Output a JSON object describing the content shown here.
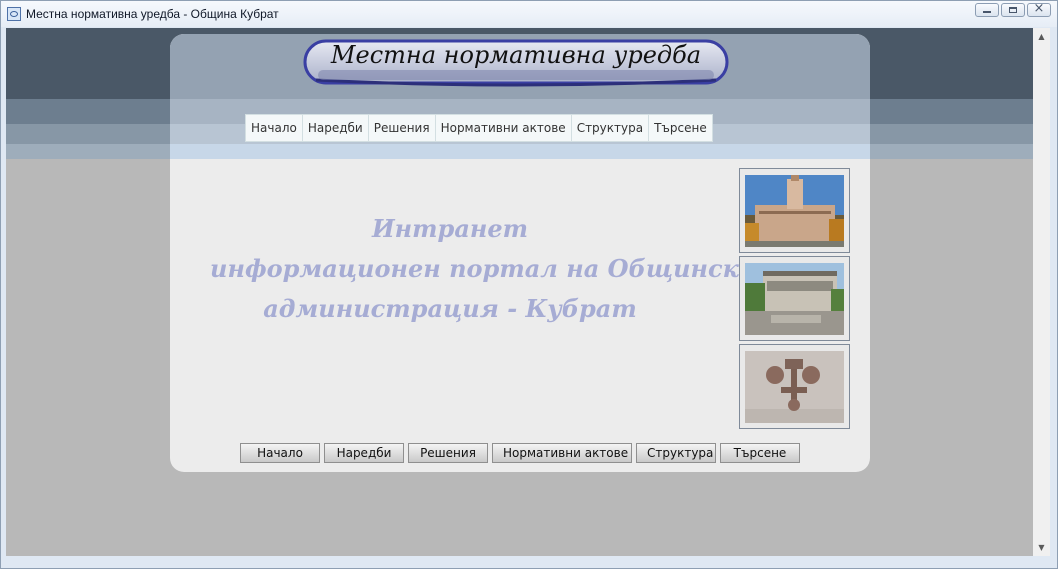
{
  "window": {
    "title": "Местна нормативна уредба - Община Кубрат"
  },
  "banner": {
    "title": "Местна нормативна уредба"
  },
  "top_nav": [
    {
      "label": "Начало"
    },
    {
      "label": "Наредби"
    },
    {
      "label": "Решения"
    },
    {
      "label": "Нормативни актове"
    },
    {
      "label": "Структура"
    },
    {
      "label": "Търсене"
    }
  ],
  "intro": {
    "line1": "Интранет",
    "line2": "информационен портал на Общинска",
    "line3": "администрация - Кубрат"
  },
  "photos": [
    {
      "name": "town-hall-photo"
    },
    {
      "name": "building-photo"
    },
    {
      "name": "monument-relief-photo"
    }
  ],
  "bottom_nav": [
    {
      "label": "Начало"
    },
    {
      "label": "Наредби"
    },
    {
      "label": "Решения"
    },
    {
      "label": "Нормативни актове"
    },
    {
      "label": "Структура"
    },
    {
      "label": "Търсене"
    }
  ],
  "colors": {
    "intro_text": "#a6acd4",
    "banner_border": "#3a3fa3",
    "header_band": "#4a5867"
  }
}
